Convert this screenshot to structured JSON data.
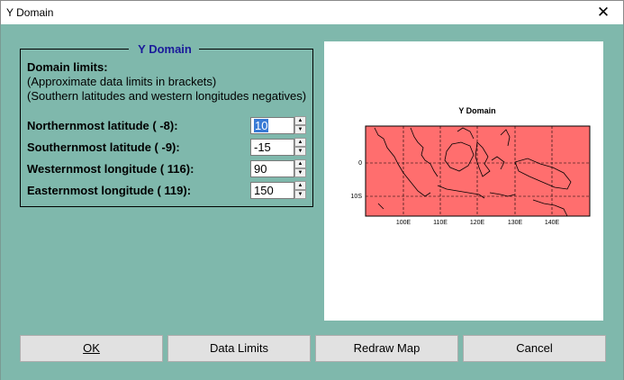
{
  "window": {
    "title": "Y Domain",
    "close_glyph": "✕"
  },
  "group": {
    "title": "Y Domain",
    "limits_heading": "Domain limits:",
    "note1": "(Approximate data limits in brackets)",
    "note2": "(Southern latitudes and western longitudes negatives)"
  },
  "fields": [
    {
      "label": "Northernmost latitude (  -8):",
      "value": "10"
    },
    {
      "label": "Southernmost latitude (  -9):",
      "value": "-15"
    },
    {
      "label": "Westernmost longitude ( 116):",
      "value": "90"
    },
    {
      "label": "Easternmost longitude ( 119):",
      "value": "150"
    }
  ],
  "map": {
    "title": "Y Domain",
    "y_ticks": [
      "0",
      "10S"
    ],
    "x_ticks": [
      "100E",
      "110E",
      "120E",
      "130E",
      "140E"
    ],
    "fill_color": "#ff6e6e"
  },
  "buttons": {
    "ok": "OK",
    "data_limits": "Data Limits",
    "redraw": "Redraw Map",
    "cancel": "Cancel"
  }
}
